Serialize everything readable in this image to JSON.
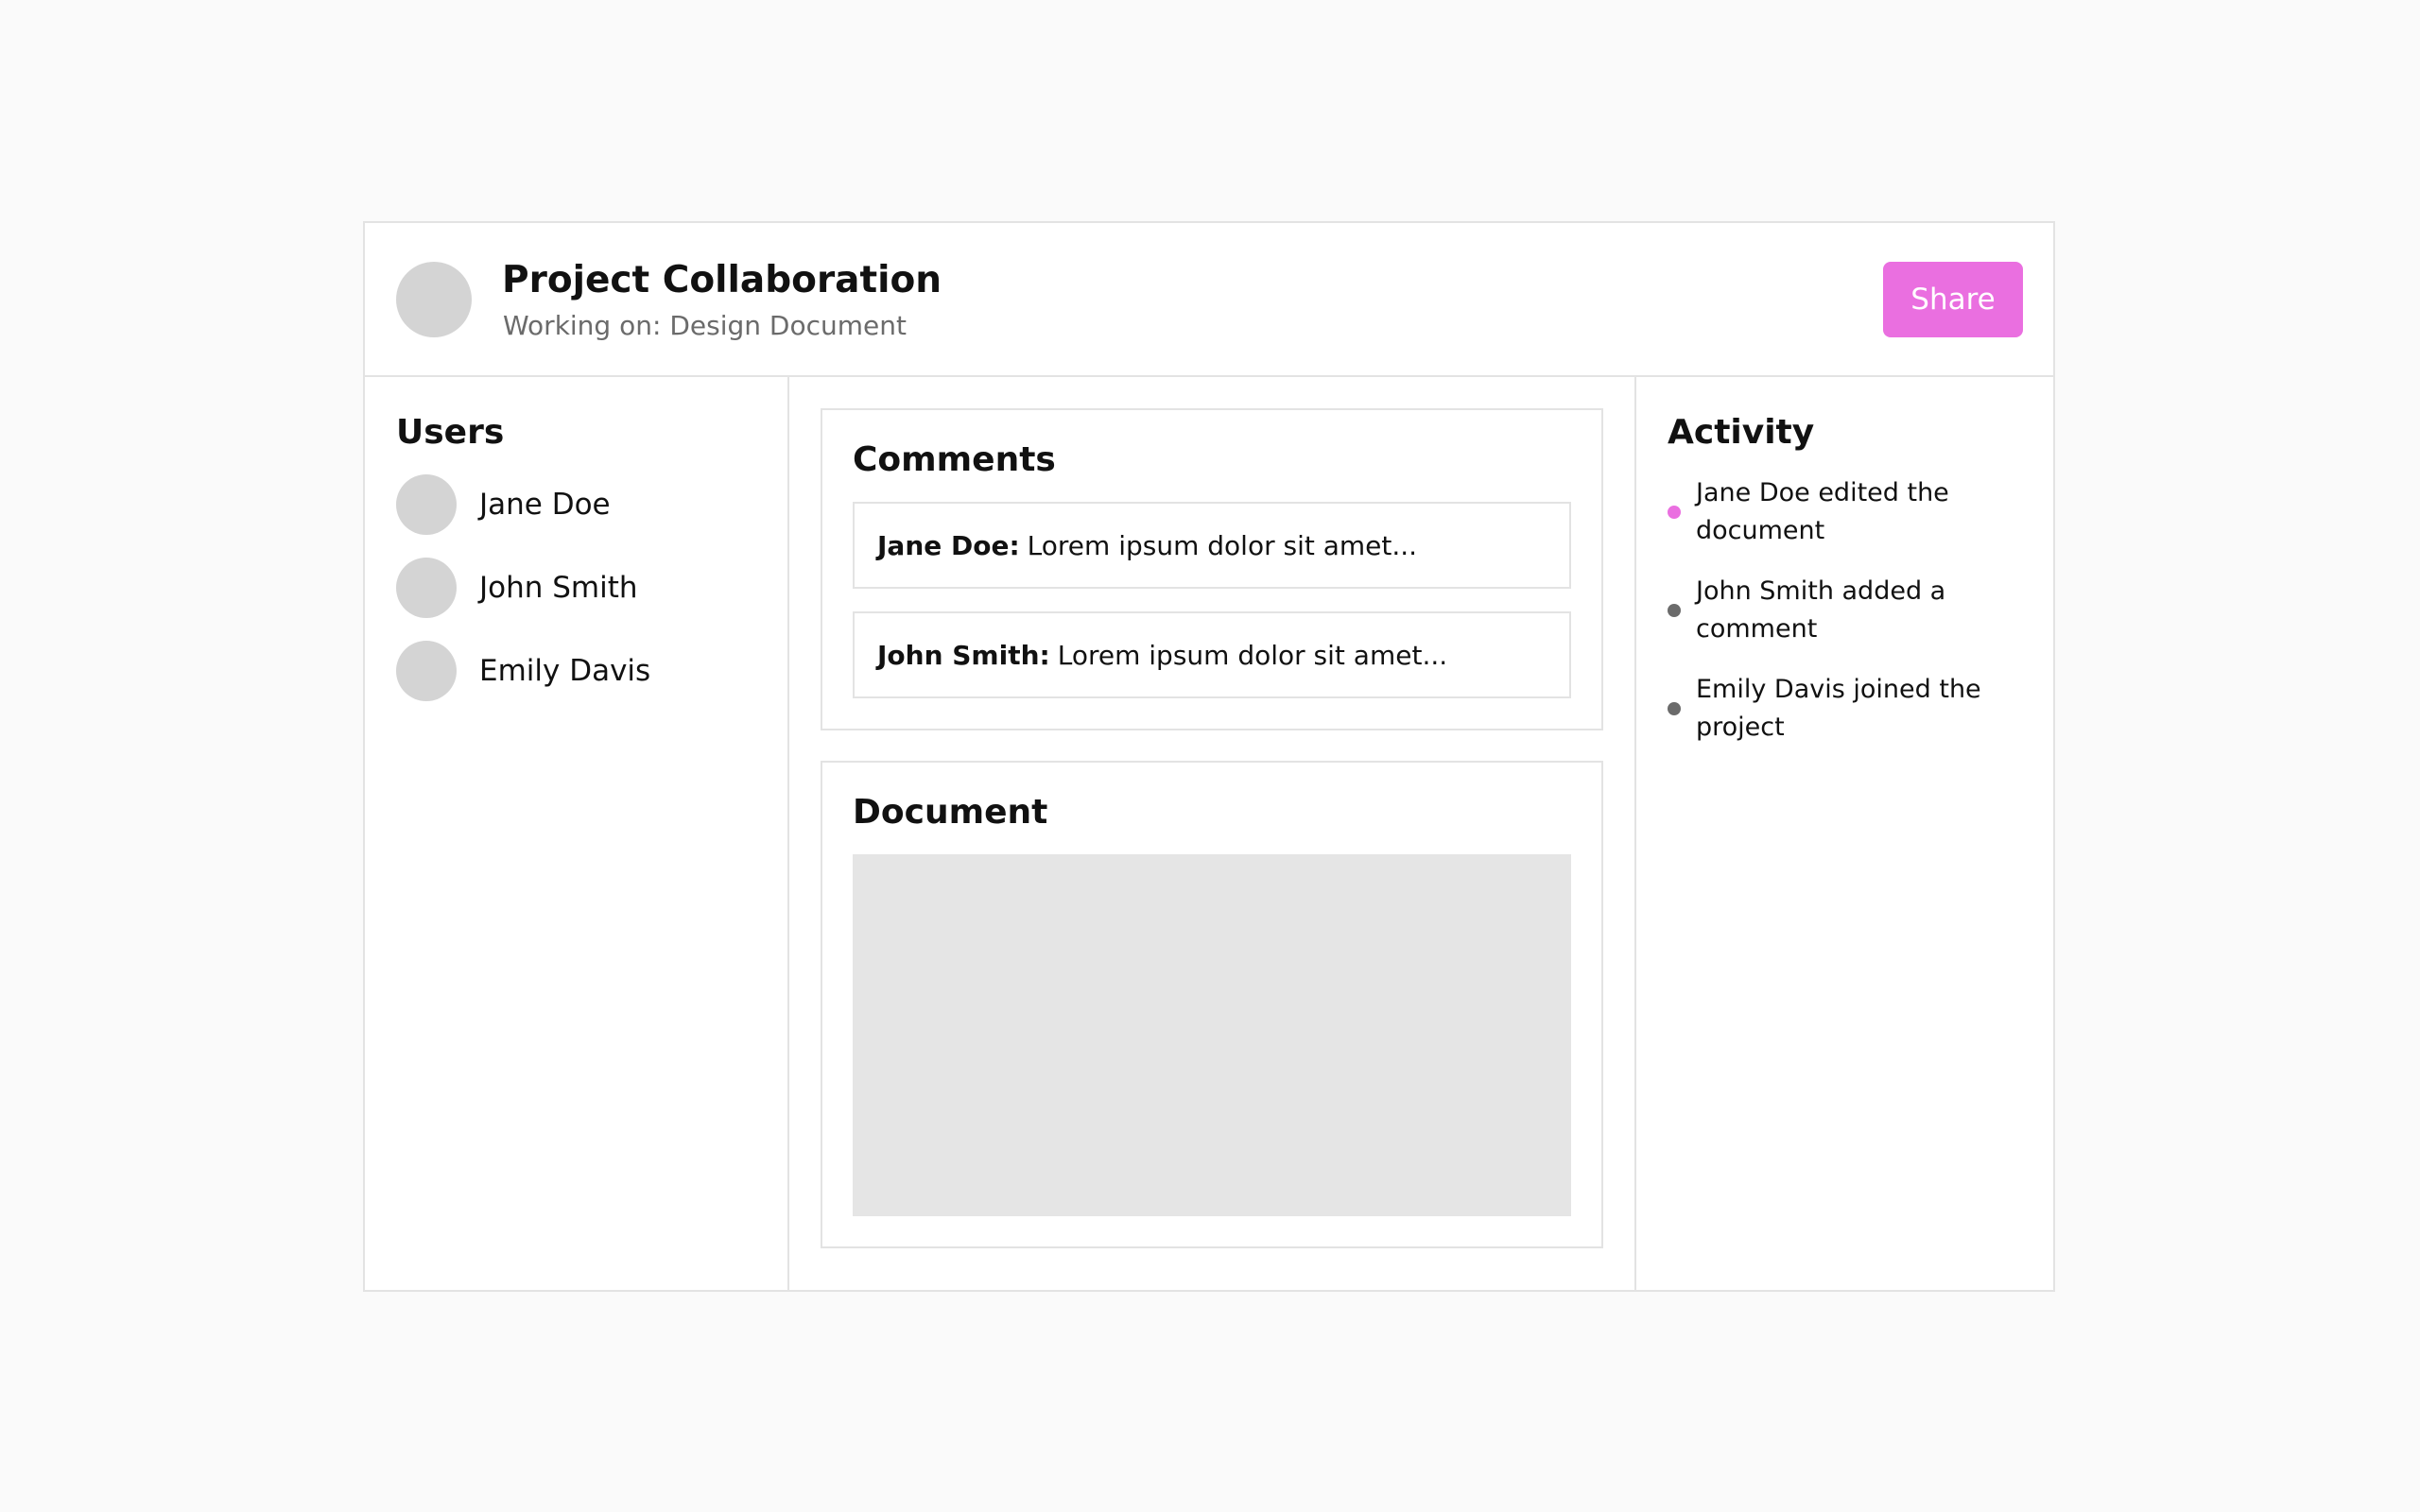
{
  "header": {
    "title": "Project Collaboration",
    "subtitle": "Working on: Design Document",
    "share_label": "Share"
  },
  "users": {
    "title": "Users",
    "items": [
      {
        "name": "Jane Doe"
      },
      {
        "name": "John Smith"
      },
      {
        "name": "Emily Davis"
      }
    ]
  },
  "comments": {
    "title": "Comments",
    "items": [
      {
        "author": "Jane Doe:",
        "text": "Lorem ipsum dolor sit amet..."
      },
      {
        "author": "John Smith:",
        "text": "Lorem ipsum dolor sit amet..."
      }
    ]
  },
  "document": {
    "title": "Document"
  },
  "activity": {
    "title": "Activity",
    "items": [
      {
        "text": "Jane Doe edited the document",
        "dot_color": "#ea6fe0"
      },
      {
        "text": "John Smith added a comment",
        "dot_color": "#6b6b6b"
      },
      {
        "text": "Emily Davis joined the project",
        "dot_color": "#6b6b6b"
      }
    ]
  },
  "colors": {
    "accent": "#ea6fe0",
    "avatar_placeholder": "#d4d4d4",
    "document_placeholder": "#e5e5e5",
    "border": "#e3e3e3"
  }
}
